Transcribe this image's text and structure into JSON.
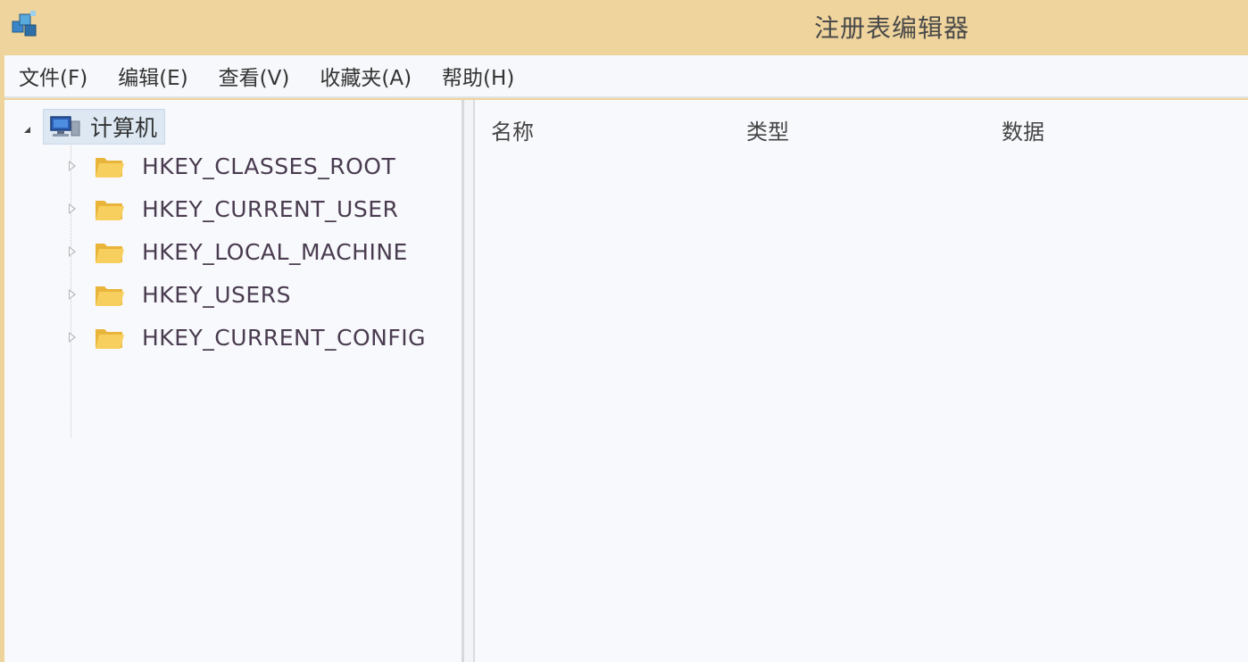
{
  "window": {
    "title": "注册表编辑器",
    "app_icon": "registry-editor-icon"
  },
  "menu": [
    {
      "label": "文件(F)"
    },
    {
      "label": "编辑(E)"
    },
    {
      "label": "查看(V)"
    },
    {
      "label": "收藏夹(A)"
    },
    {
      "label": "帮助(H)"
    }
  ],
  "tree": {
    "root": {
      "label": "计算机",
      "icon": "computer-icon",
      "expanded": true,
      "selected": true
    },
    "keys": [
      {
        "label": "HKEY_CLASSES_ROOT",
        "icon": "folder-icon"
      },
      {
        "label": "HKEY_CURRENT_USER",
        "icon": "folder-icon"
      },
      {
        "label": "HKEY_LOCAL_MACHINE",
        "icon": "folder-icon"
      },
      {
        "label": "HKEY_USERS",
        "icon": "folder-icon"
      },
      {
        "label": "HKEY_CURRENT_CONFIG",
        "icon": "folder-icon"
      }
    ]
  },
  "values_pane": {
    "columns": [
      {
        "label": "名称"
      },
      {
        "label": "类型"
      },
      {
        "label": "数据"
      }
    ]
  },
  "colors": {
    "titlebar": "#efd49d",
    "pane_background": "#f8f9fc",
    "selection": "#dde8f3",
    "folder": "#f2c24f"
  }
}
